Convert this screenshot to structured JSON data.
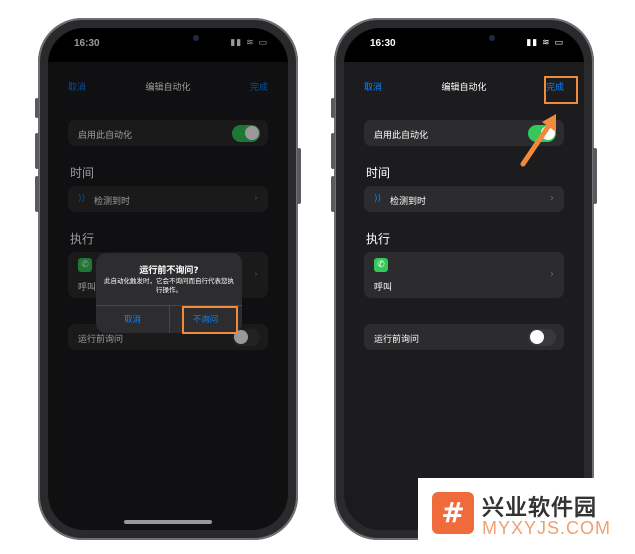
{
  "status_time": "16:30",
  "nav": {
    "cancel": "取消",
    "title": "编辑自动化",
    "done": "完成"
  },
  "enable_label": "启用此自动化",
  "section_time": "时间",
  "trigger_label": "检测到时",
  "section_do": "执行",
  "action_label": "呼叫",
  "ask_label": "运行前询问",
  "dialog": {
    "title": "运行前不询问?",
    "message": "此自动化触发时，它会不询问而自行代表您执行操作。",
    "cancel": "取消",
    "confirm": "不询问"
  },
  "watermark": {
    "name": "兴业软件园",
    "url": "MYXYJS.COM",
    "logo": "#"
  },
  "colors": {
    "accent": "#0a84ff",
    "toggle_on": "#34c759",
    "highlight": "#f08a3c"
  }
}
